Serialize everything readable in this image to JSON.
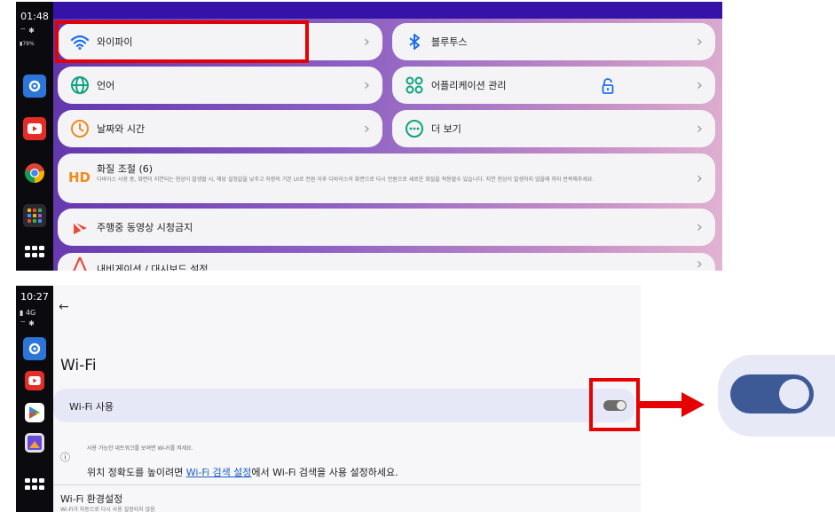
{
  "top": {
    "time": "01:48",
    "battery": "79%",
    "cards": [
      {
        "label": "와이파이",
        "icon": "wifi-icon"
      },
      {
        "label": "블루투스",
        "icon": "bluetooth-icon"
      },
      {
        "label": "언어",
        "icon": "globe-icon"
      },
      {
        "label": "어플리케이션 관리",
        "icon": "apps-icon"
      },
      {
        "label": "날짜와 시간",
        "icon": "clock-icon"
      },
      {
        "label": "더 보기",
        "icon": "more-icon"
      },
      {
        "label": "화질 조절 (6)",
        "icon": "hd-icon",
        "desc": "디바이스 사용 중, 화면이 지연되는 현상이 발생할 시, 해당 설정값을 낮추고 차량의 기본 UI로 전원 이후 디바이스의 화면으로 다시 전원으로 새로운 화질을 적용할수 있습니다. 지연 현상이 발생하지 않을때 까지 반복해주세요."
      },
      {
        "label": "주행중 동영상 시청금지",
        "icon": "no-video-icon"
      },
      {
        "label": "내비게이션 / 대시보드 설정",
        "icon": "navigation-icon"
      }
    ],
    "hd_badge": "HD"
  },
  "bottom": {
    "time": "10:27",
    "signal": "4G",
    "title": "Wi-Fi",
    "wifi_use_label": "Wi-Fi 사용",
    "wifi_enabled": false,
    "hint": "사용 가능한 네트워크를 보려면 Wi-Fi를 켜세요.",
    "msg_before": "위치 정확도를 높이려면 ",
    "msg_link": "Wi-Fi 검색 설정",
    "msg_after": "에서 Wi-Fi 검색을 사용 설정하세요.",
    "env_title": "Wi-Fi 환경설정",
    "env_sub": "Wi-Fi가 자동으로 다시 사용 설정되지 않음"
  },
  "zoom": {
    "wifi_enabled": true
  },
  "colors": {
    "highlight": "#e60000",
    "accent": "#1a5dc4"
  }
}
